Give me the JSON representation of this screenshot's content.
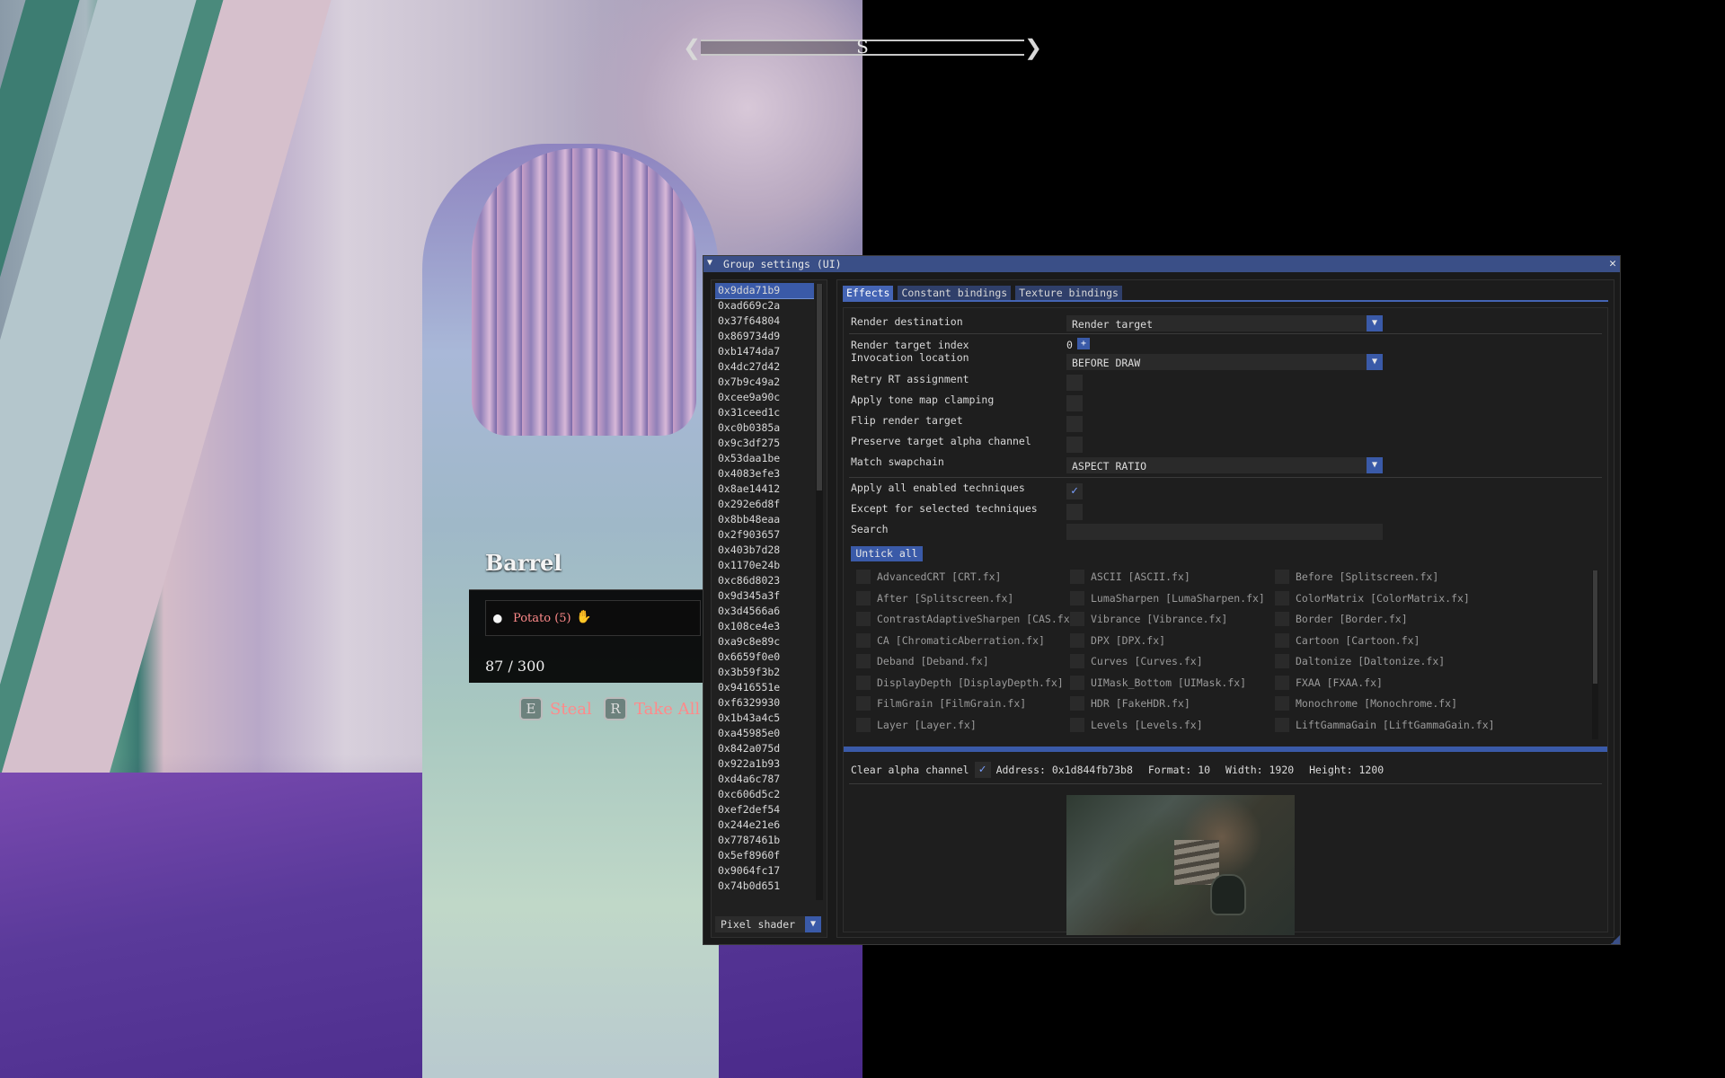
{
  "compass": {
    "direction": "S",
    "cap_left": "❮",
    "cap_right": "❯"
  },
  "hud": {
    "title": "Barrel",
    "item_icon": "apple-icon",
    "item_name": "Potato (5)",
    "hand_icon": "hand-icon",
    "weight": "87 / 300",
    "actions": [
      {
        "key": "E",
        "label": "Steal"
      },
      {
        "key": "R",
        "label": "Take All"
      }
    ]
  },
  "window": {
    "title": "Group settings (UI)",
    "collapse_glyph": "▼",
    "close_glyph": "✕",
    "shaders": [
      "0x9dda71b9",
      "0xad669c2a",
      "0x37f64804",
      "0x869734d9",
      "0xb1474da7",
      "0x4dc27d42",
      "0x7b9c49a2",
      "0xcee9a90c",
      "0x31ceed1c",
      "0xc0b0385a",
      "0x9c3df275",
      "0x53daa1be",
      "0x4083efe3",
      "0x8ae14412",
      "0x292e6d8f",
      "0x8bb48eaa",
      "0x2f903657",
      "0x403b7d28",
      "0x1170e24b",
      "0xc86d8023",
      "0x9d345a3f",
      "0x3d4566a6",
      "0x108ce4e3",
      "0xa9c8e89c",
      "0x6659f0e0",
      "0x3b59f3b2",
      "0x9416551e",
      "0xf6329930",
      "0x1b43a4c5",
      "0xa45985e0",
      "0x842a075d",
      "0x922a1b93",
      "0xd4a6c787",
      "0xc606d5c2",
      "0xef2def54",
      "0x244e21e6",
      "0x7787461b",
      "0x5ef8960f",
      "0x9064fc17",
      "0x74b0d651"
    ],
    "shader_type": "Pixel shader",
    "tabs": [
      "Effects",
      "Constant bindings",
      "Texture bindings"
    ],
    "labels": {
      "render_destination": "Render destination",
      "render_target_index": "Render target index",
      "invocation_location": "Invocation location",
      "retry_rt": "Retry RT assignment",
      "tone_map": "Apply tone map clamping",
      "flip_rt": "Flip render target",
      "preserve_alpha": "Preserve target alpha channel",
      "match_swapchain": "Match swapchain",
      "apply_all": "Apply all enabled techniques",
      "except_selected": "Except for selected techniques",
      "search": "Search"
    },
    "values": {
      "render_destination": "Render target",
      "render_target_index": "0",
      "invocation_location": "BEFORE DRAW",
      "match_swapchain": "ASPECT RATIO",
      "search": ""
    },
    "checks": {
      "retry_rt": false,
      "tone_map": false,
      "flip_rt": false,
      "preserve_alpha": false,
      "apply_all": true,
      "except_selected": false,
      "clear_alpha": true
    },
    "untick_all": "Untick all",
    "plus": "+",
    "checkmark": "✓",
    "techniques": [
      [
        "AdvancedCRT [CRT.fx]",
        "ASCII [ASCII.fx]",
        "Before [Splitscreen.fx]"
      ],
      [
        "After [Splitscreen.fx]",
        "LumaSharpen [LumaSharpen.fx]",
        "ColorMatrix [ColorMatrix.fx]"
      ],
      [
        "ContrastAdaptiveSharpen [CAS.fx]",
        "Vibrance [Vibrance.fx]",
        "Border [Border.fx]"
      ],
      [
        "CA [ChromaticAberration.fx]",
        "DPX [DPX.fx]",
        "Cartoon [Cartoon.fx]"
      ],
      [
        "Deband [Deband.fx]",
        "Curves [Curves.fx]",
        "Daltonize [Daltonize.fx]"
      ],
      [
        "DisplayDepth [DisplayDepth.fx]",
        "UIMask_Bottom [UIMask.fx]",
        "FXAA [FXAA.fx]"
      ],
      [
        "FilmGrain [FilmGrain.fx]",
        "HDR [FakeHDR.fx]",
        "Monochrome [Monochrome.fx]"
      ],
      [
        "Layer [Layer.fx]",
        "Levels [Levels.fx]",
        "LiftGammaGain [LiftGammaGain.fx]"
      ]
    ],
    "clear_alpha_label": "Clear alpha channel",
    "rt_info": {
      "address": "Address: 0x1d844fb73b8",
      "format": "Format: 10",
      "width": "Width: 1920",
      "height": "Height: 1200"
    }
  },
  "colors": {
    "accent": "#3a5aa8",
    "title_bar": "#3a4f87",
    "hud_red": "#ff8a8a"
  }
}
